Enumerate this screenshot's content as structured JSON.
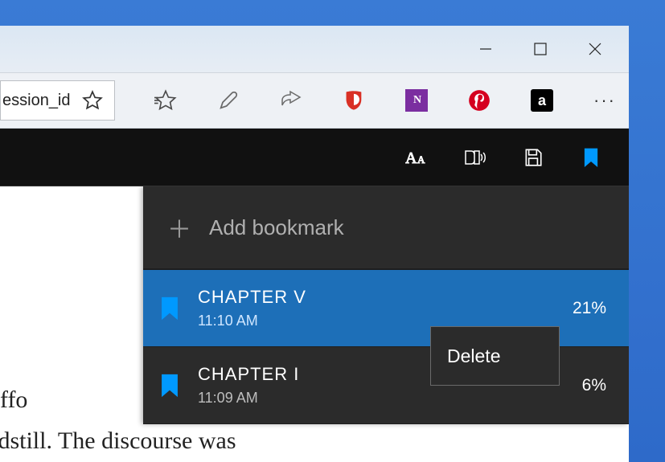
{
  "window": {
    "minimize": "–",
    "maximize": "□",
    "close": "×"
  },
  "address": {
    "text_fragment": "ession_id"
  },
  "toolbar": {
    "favorites_star": "star-outline-icon",
    "reading_star": "star-burst-icon",
    "pen": "pen-icon",
    "share": "share-icon",
    "ext_ublock": "ublock-icon",
    "ext_onenote_label": "N",
    "ext_pinterest": "pinterest-icon",
    "ext_amazon_label": "a",
    "more": "···"
  },
  "reader": {
    "font": "font-size-icon",
    "read_aloud": "read-aloud-icon",
    "save": "save-icon",
    "bookmark": "bookmark-icon"
  },
  "bookmarks_panel": {
    "add_label": "Add bookmark",
    "items": [
      {
        "title": "CHAPTER V",
        "time": "11:10 AM",
        "percent": "21%",
        "selected": true
      },
      {
        "title": "CHAPTER I",
        "time": "11:09 AM",
        "percent": "6%",
        "selected": false
      }
    ]
  },
  "context_menu": {
    "delete": "Delete"
  },
  "page_body": {
    "line1": "d and suffo",
    "line2": "ead standstill. The discourse was"
  }
}
